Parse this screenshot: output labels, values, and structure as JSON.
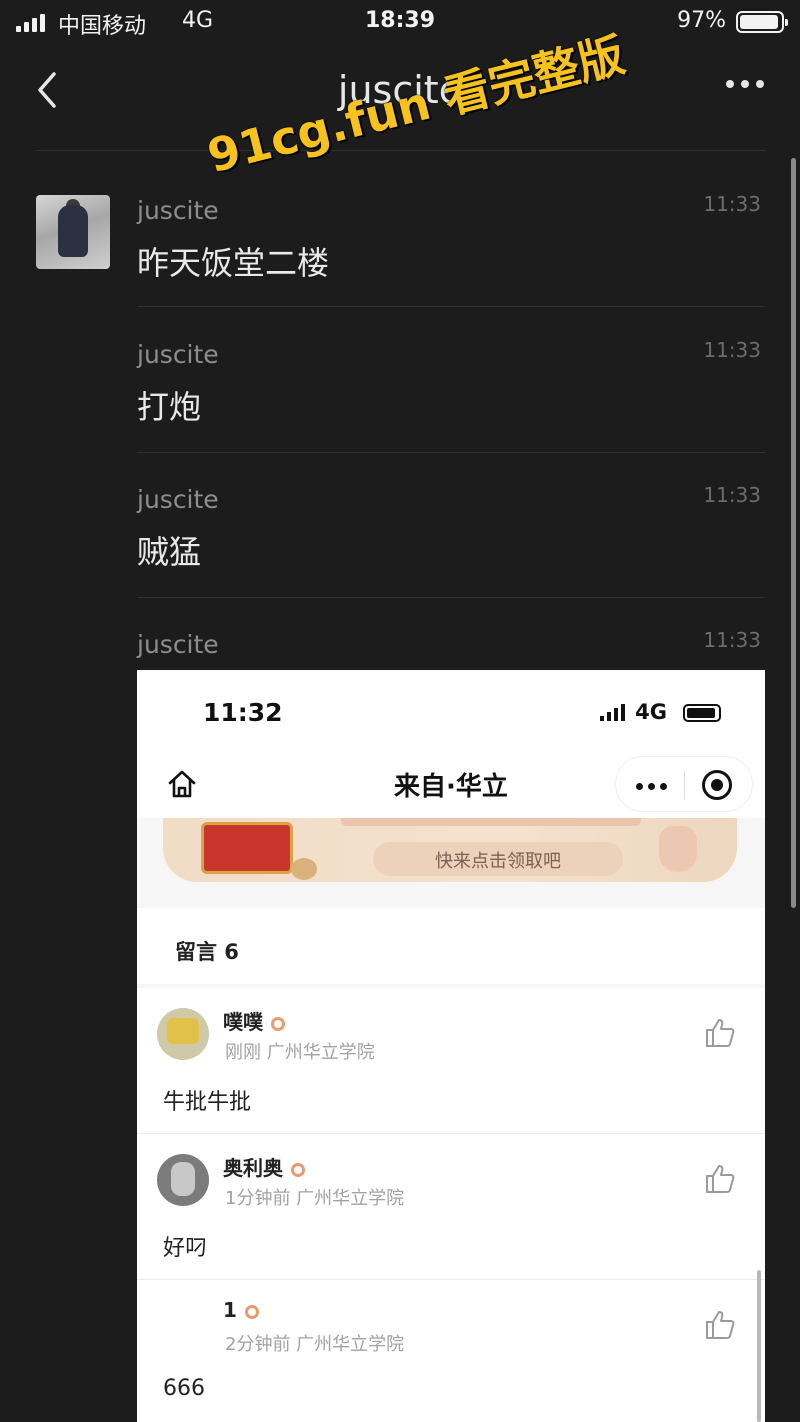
{
  "status_bar": {
    "carrier": "中国移动",
    "network": "4G",
    "time": "18:39",
    "battery": "97%"
  },
  "header": {
    "back_icon": "chevron-left-icon",
    "title": "juscite",
    "more_icon": "more-dots-icon"
  },
  "watermark": "91cg.fun 看完整版",
  "messages": [
    {
      "sender": "juscite",
      "time": "11:33",
      "text": "昨天饭堂二楼"
    },
    {
      "sender": "juscite",
      "time": "11:33",
      "text": "打炮"
    },
    {
      "sender": "juscite",
      "time": "11:33",
      "text": "贼猛"
    },
    {
      "sender": "juscite",
      "time": "11:33",
      "text": ""
    }
  ],
  "screenshot": {
    "status": {
      "time": "11:32",
      "network": "4G"
    },
    "nav": {
      "title": "来自·华立",
      "home_icon": "home-icon",
      "more_icon": "more-dots-icon",
      "target_icon": "target-icon"
    },
    "banner": {
      "button_text": "快来点击领取吧"
    },
    "comments_header": "留言 6",
    "comments": [
      {
        "name": "噗噗",
        "meta": "刚刚  广州华立学院",
        "text": "牛批牛批",
        "like_icon": "thumbs-up-icon"
      },
      {
        "name": "奥利奥",
        "meta": "1分钟前  广州华立学院",
        "text": "好叼",
        "like_icon": "thumbs-up-icon"
      },
      {
        "name": "1",
        "meta": "2分钟前  广州华立学院",
        "text": "666",
        "like_icon": "thumbs-up-icon"
      }
    ]
  },
  "colors": {
    "background": "#1c1c1c",
    "watermark": "#f6c21b",
    "badge": "#e79b6f"
  }
}
